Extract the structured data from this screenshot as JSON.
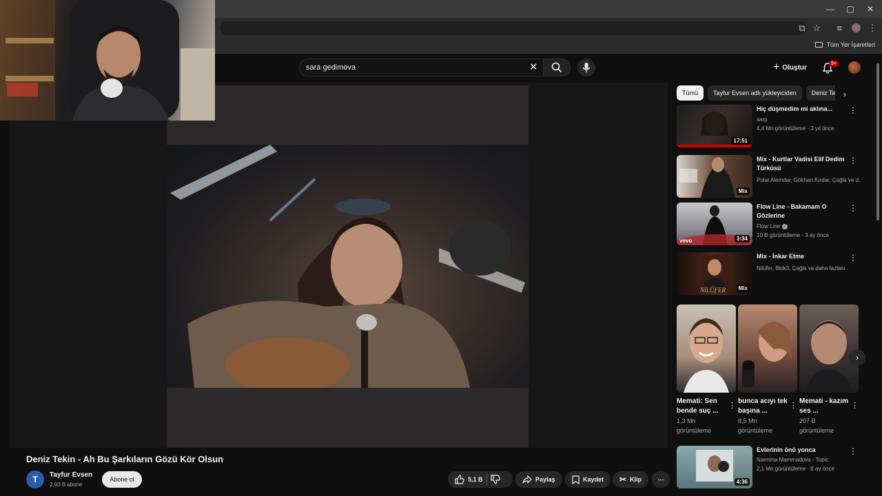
{
  "browser": {
    "bookmarks_bar_label": "Tüm Yer İşaretleri",
    "icons": [
      "minimize-icon",
      "maximize-icon",
      "close-icon",
      "install-icon",
      "star-icon",
      "media-icon",
      "profile-icon",
      "menu-icon"
    ]
  },
  "header": {
    "search_query": "sara gedimova",
    "create_label": "Oluştur",
    "notification_badge": "9+"
  },
  "video": {
    "title": "Deniz Tekin - Ah Bu Şarkıların Gözü Kör Olsun",
    "channel": {
      "initial": "T",
      "name": "Tayfur Evsen",
      "subscribers": "2,93 B abone"
    },
    "subscribe_label": "Abone ol",
    "actions": {
      "like_count": "5,1 B",
      "share": "Paylaş",
      "save": "Kaydet",
      "clip": "Klip",
      "more": "⋯"
    }
  },
  "sidebar": {
    "chips": [
      "Tümü",
      "Tayfur Evsen adlı yükleyiciden",
      "Deniz Tekin"
    ],
    "recommendations": [
      {
        "title": "Hiç düşmedim mi aklına...",
        "channel": "sarp",
        "meta": "4,4 Mn görüntüleme · 3 yıl önce",
        "duration": "17:51"
      },
      {
        "title": "Mix - Kurtlar Vadisi Elif Dedim Türküsü",
        "channel": "Polat Alemdar, Gökhan Kırdar, Çağla ve d...",
        "meta": "",
        "duration": "Mix"
      },
      {
        "title": "Flow Line - Bakamam O Gözlerine",
        "channel": "Flow Line",
        "meta": "10 B görüntüleme · 3 ay önce",
        "duration": "3:34"
      },
      {
        "title": "Mix - İnkar Etme",
        "channel": "Nilüfer, Blok3, Çağla ve daha fazlası",
        "meta": "",
        "duration": "Mix"
      }
    ],
    "shorts": [
      {
        "title": "Memati: Sen bende suç ...",
        "views": "1,3 Mn görüntüleme"
      },
      {
        "title": "bunca acıyı tek başına ...",
        "views": "8,5 Mn görüntüleme"
      },
      {
        "title": "Memati - kazım ses ...",
        "views": "207 B görüntüleme"
      }
    ],
    "last_rec": {
      "title": "Evlerinin önü yonca",
      "channel": "Nərmina Mammadova - Topic",
      "meta": "2,1 Mn görüntüleme · 8 ay önce",
      "duration": "4:36"
    }
  },
  "colors": {
    "background": "#0f0f0f",
    "accent_red": "#cc0000",
    "channel_avatar": "#2a5db0"
  }
}
